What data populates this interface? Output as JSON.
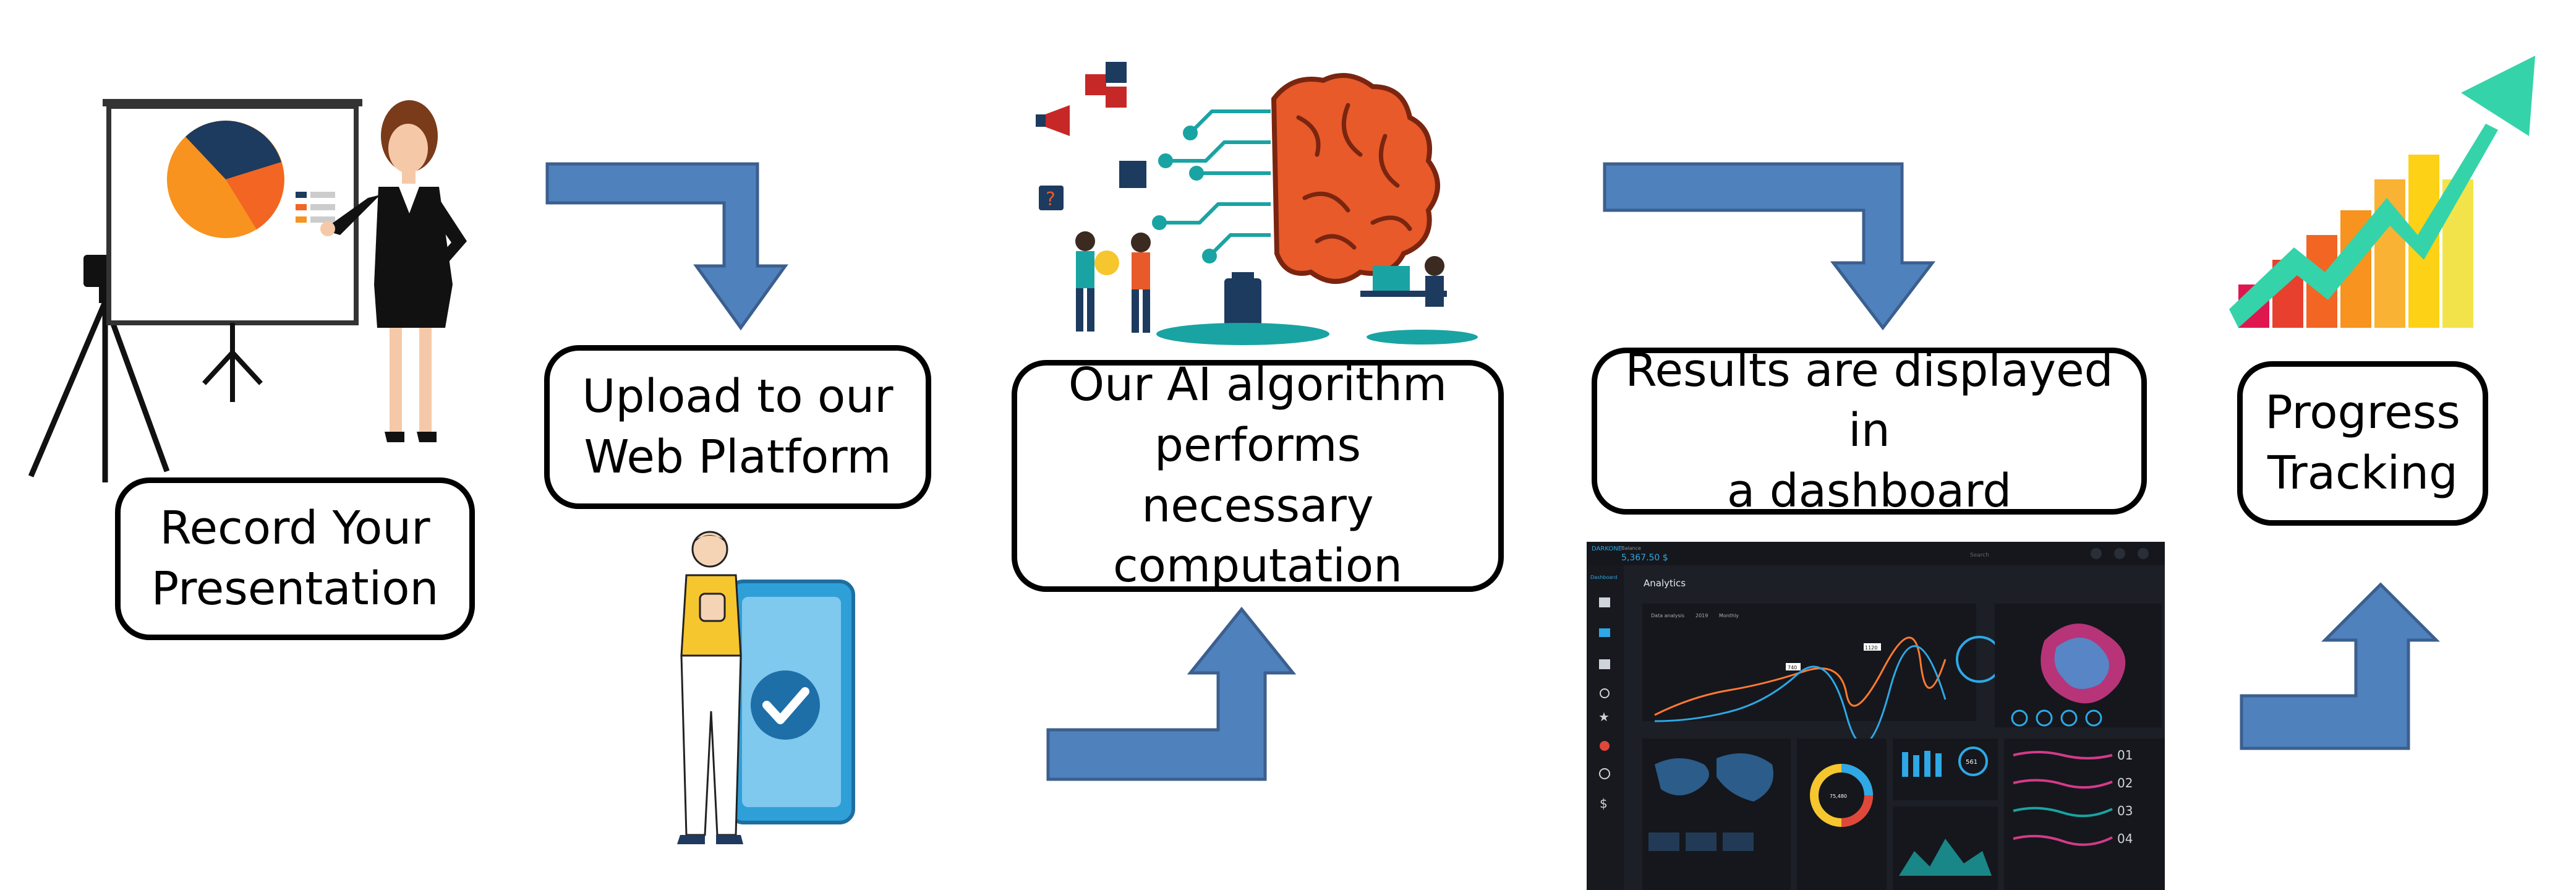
{
  "steps": [
    {
      "id": "record",
      "label": "Record Your\nPresentation"
    },
    {
      "id": "upload",
      "label": "Upload to our\nWeb Platform"
    },
    {
      "id": "ai",
      "label": "Our AI algorithm\nperforms necessary\ncomputation"
    },
    {
      "id": "results",
      "label": "Results are displayed in\na dashboard"
    },
    {
      "id": "progress",
      "label": "Progress\nTracking"
    }
  ],
  "dashboard": {
    "brand": "DARKONE",
    "balance_label": "Balance",
    "balance_value": "5,367.50 $",
    "search_placeholder": "Search",
    "nav_active": "Dashboard",
    "title": "Analytics",
    "legend": [
      "Data analysis",
      "2019",
      "Monthly"
    ],
    "callouts": [
      "740",
      "1120"
    ],
    "list_numbers": [
      "01",
      "02",
      "03",
      "04"
    ],
    "gauge_value": "561",
    "donut_label": "75,480"
  },
  "colors": {
    "arrow_fill": "#4f81bd",
    "arrow_stroke": "#3b5f8e",
    "box_border": "#000000",
    "dashboard_bg": "#1c1f26",
    "dashboard_line_orange": "#ff7a30",
    "dashboard_line_blue": "#2ea8e6",
    "progress_arrow": "#35d3a9"
  },
  "icons": [
    "presenter-with-pie-chart",
    "camera-tripod",
    "person-with-phone-checkmark",
    "ai-brain-circuit",
    "analytics-dashboard",
    "rising-bar-chart-arrow"
  ]
}
